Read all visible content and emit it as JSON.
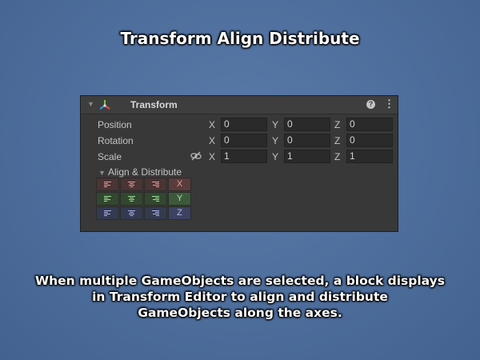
{
  "page": {
    "title": "Transform Align Distribute",
    "caption_lines": [
      "When multiple GameObjects are selected, a block displays",
      "in Transform Editor to align and distribute",
      "GameObjects along the axes."
    ]
  },
  "inspector": {
    "component_title": "Transform",
    "icons": [
      "foldout-arrow-icon",
      "transform-axes-icon",
      "help-icon",
      "context-menu-icon",
      "constrain-proportions-link-icon"
    ],
    "rows": [
      {
        "label": "Position",
        "x": "0",
        "y": "0",
        "z": "0"
      },
      {
        "label": "Rotation",
        "x": "0",
        "y": "0",
        "z": "0"
      },
      {
        "label": "Scale",
        "x": "1",
        "y": "1",
        "z": "1"
      }
    ],
    "axes": [
      "X",
      "Y",
      "Z"
    ],
    "align_distribute": {
      "label": "Align & Distribute",
      "axis_labels": [
        "X",
        "Y",
        "Z"
      ],
      "icons": [
        "align-min-icon",
        "align-center-icon",
        "align-max-icon"
      ],
      "colors": {
        "x_row_bg": "#4a3434",
        "x_row_label_bg": "#5a3c3c",
        "x_icon": "#e29b9b",
        "y_row_bg": "#33462f",
        "y_row_label_bg": "#3c5a3a",
        "y_icon": "#9ce29b",
        "z_row_bg": "#343a4f",
        "z_row_label_bg": "#3c4260",
        "z_icon": "#a9b4e8"
      }
    }
  }
}
